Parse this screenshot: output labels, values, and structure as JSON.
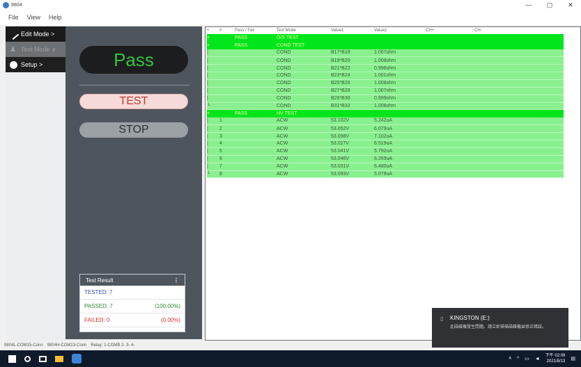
{
  "window": {
    "title": "9804",
    "controls": [
      "—",
      "▢",
      "✕"
    ]
  },
  "menu": [
    "File",
    "View",
    "Help"
  ],
  "nav": {
    "edit_mode": "Edit Mode >",
    "test_mode": "Test Mode ∨",
    "setup": "Setup >"
  },
  "panel": {
    "status": "Pass",
    "status_color": "#33c33a",
    "test_button": "TEST",
    "stop_button": "STOP"
  },
  "result": {
    "title": "Test Result",
    "tested_label": "TESTED:",
    "tested_value": "7",
    "passed_label": "PASSED:",
    "passed_value": "7",
    "passed_pct": "(100.00%)",
    "failed_label": "FAILED:",
    "failed_value": "0",
    "failed_pct": "(0.00%)"
  },
  "table": {
    "headers": [
      "+",
      "#",
      "Pass / Fail",
      "Test Mode",
      "Value1",
      "Value2",
      "CH+",
      "CH-"
    ],
    "rows": [
      {
        "type": "group",
        "c0": "+",
        "c1": "",
        "c2": "PASS",
        "c3": "O/S TEST",
        "c4": "",
        "c5": ""
      },
      {
        "type": "group",
        "c0": "+",
        "c1": "",
        "c2": "PASS",
        "c3": "COND TEST",
        "c4": "",
        "c5": ""
      },
      {
        "type": "item",
        "c0": "|",
        "c1": "",
        "c2": "",
        "c3": "COND",
        "c4": "B17*B18",
        "c5": "1.007ohm"
      },
      {
        "type": "item",
        "c0": "|",
        "c1": "",
        "c2": "",
        "c3": "COND",
        "c4": "B19*B20",
        "c5": "1.008ohm"
      },
      {
        "type": "item",
        "c0": "|",
        "c1": "",
        "c2": "",
        "c3": "COND",
        "c4": "B21*B22",
        "c5": "0.996ohm"
      },
      {
        "type": "item",
        "c0": "|",
        "c1": "",
        "c2": "",
        "c3": "COND",
        "c4": "B23*B24",
        "c5": "1.001ohm"
      },
      {
        "type": "item",
        "c0": "|",
        "c1": "",
        "c2": "",
        "c3": "COND",
        "c4": "B25*B26",
        "c5": "1.008ohm"
      },
      {
        "type": "item",
        "c0": "|",
        "c1": "",
        "c2": "",
        "c3": "COND",
        "c4": "B27*B28",
        "c5": "1.007ohm"
      },
      {
        "type": "item",
        "c0": "|",
        "c1": "",
        "c2": "",
        "c3": "COND",
        "c4": "B29*B30",
        "c5": "0.999ohm"
      },
      {
        "type": "item",
        "c0": "└",
        "c1": "",
        "c2": "",
        "c3": "COND",
        "c4": "B31*B32",
        "c5": "1.008ohm"
      },
      {
        "type": "group",
        "c0": "+",
        "c1": "",
        "c2": "PASS",
        "c3": "HV TEST",
        "c4": "",
        "c5": ""
      },
      {
        "type": "item",
        "c0": "|",
        "c1": "1",
        "c2": "",
        "c3": "ACW",
        "c4": "53.102V",
        "c5": "5.242uA"
      },
      {
        "type": "item",
        "c0": "|",
        "c1": "2",
        "c2": "",
        "c3": "ACW",
        "c4": "53.052V",
        "c5": "6.079uA"
      },
      {
        "type": "item",
        "c0": "|",
        "c1": "3",
        "c2": "",
        "c3": "ACW",
        "c4": "53.098V",
        "c5": "7.102uA"
      },
      {
        "type": "item",
        "c0": "|",
        "c1": "4",
        "c2": "",
        "c3": "ACW",
        "c4": "53.027V",
        "c5": "6.519uA"
      },
      {
        "type": "item",
        "c0": "|",
        "c1": "5",
        "c2": "",
        "c3": "ACW",
        "c4": "53.041V",
        "c5": "5.792uA"
      },
      {
        "type": "item",
        "c0": "|",
        "c1": "6",
        "c2": "",
        "c3": "ACW",
        "c4": "53.046V",
        "c5": "6.269uA"
      },
      {
        "type": "item",
        "c0": "|",
        "c1": "7",
        "c2": "",
        "c3": "ACW",
        "c4": "53.031V",
        "c5": "6.480uA"
      },
      {
        "type": "item",
        "c0": "└",
        "c1": "8",
        "c2": "",
        "c3": "ACW",
        "c4": "53.093V",
        "c5": "5.079uA"
      }
    ]
  },
  "statusbar": [
    "9804L-COM15-Conn",
    "9804H-COM13-Conn",
    "Relay: 1-COMB 2- 3- 4-"
  ],
  "toast": {
    "title": "KINGSTON (E:)",
    "body": "此磁碟機發生問題。請立即掃描磁碟機並修正錯誤。"
  },
  "taskbar": {
    "time": "下午 02:09",
    "date": "2021/8/13"
  },
  "colors": {
    "group_row": "#00e51c",
    "item_row": "#8af08f",
    "panel_bg": "#4f555d"
  }
}
